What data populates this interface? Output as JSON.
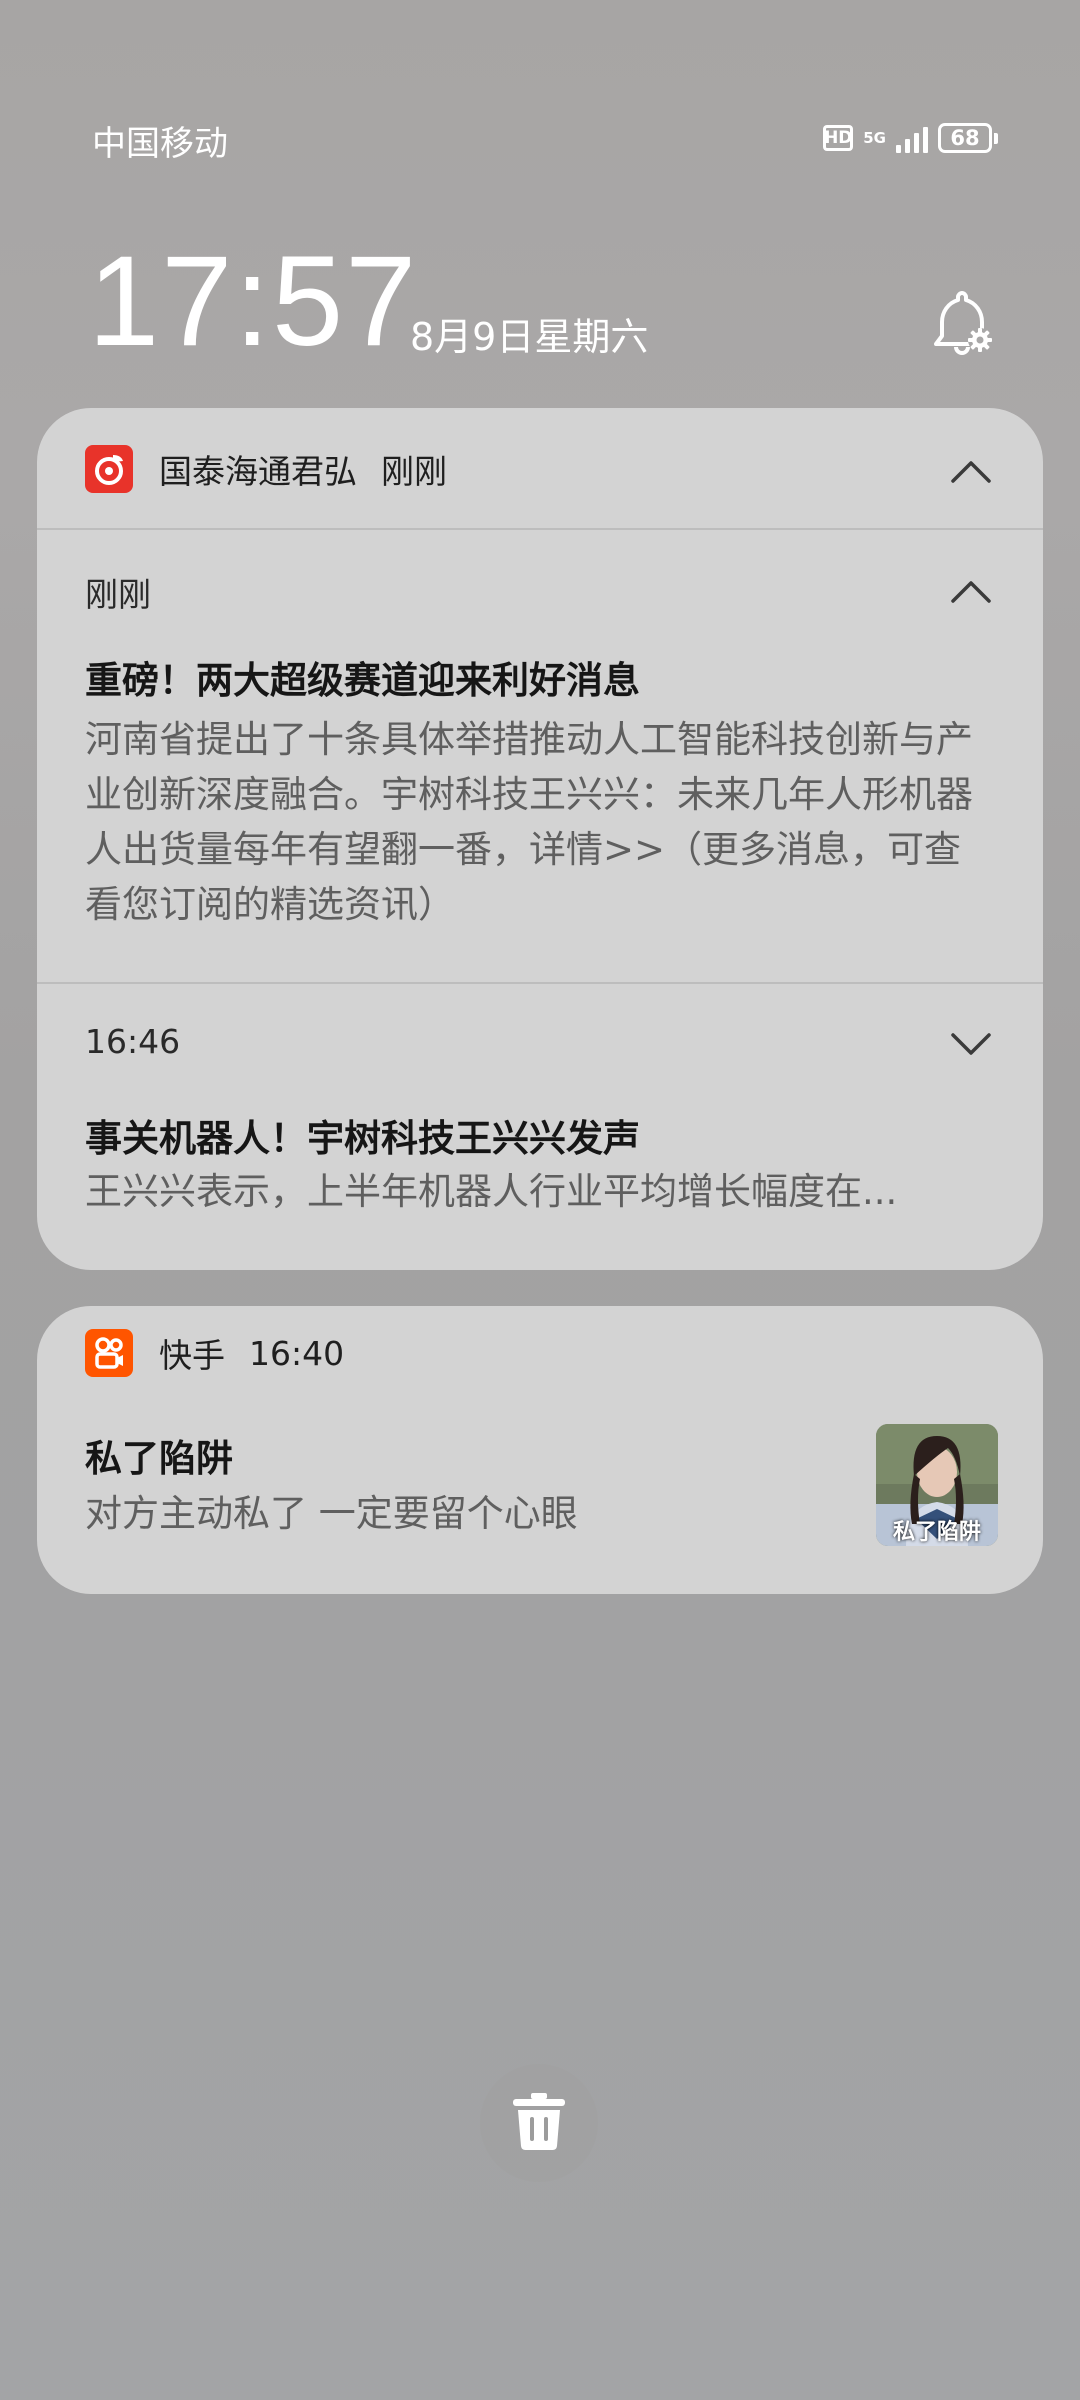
{
  "status_bar": {
    "carrier": "中国移动",
    "hd_label": "HD",
    "network_label": "5G",
    "battery_level": "68",
    "icons": [
      "hd-icon",
      "5g-icon",
      "signal-icon",
      "battery-icon"
    ]
  },
  "lockscreen": {
    "time": "17:57",
    "date": "8月9日星期六",
    "settings_icon": "notification-settings-icon"
  },
  "notifications": [
    {
      "app_name": "国泰海通君弘",
      "app_time": "刚刚",
      "app_icon": "guotai-haitong-app-icon",
      "accent_color": "#e8332a",
      "groups": [
        {
          "time": "刚刚",
          "title": "重磅！两大超级赛道迎来利好消息",
          "body": "河南省提出了十条具体举措推动人工智能科技创新与产业创新深度融合。宇树科技王兴兴：未来几年人形机器人出货量每年有望翻一番，详情>>（更多消息，可查看您订阅的精选资讯）"
        },
        {
          "time": "16:46",
          "title": "事关机器人！宇树科技王兴兴发声",
          "body": "王兴兴表示，上半年机器人行业平均增长幅度在..."
        }
      ]
    },
    {
      "app_name": "快手",
      "app_time": "16:40",
      "app_icon": "kuaishou-app-icon",
      "accent_color": "#ff5500",
      "title": "私了陷阱",
      "body": "对方主动私了 一定要留个心眼",
      "thumbnail_caption": "私了陷阱"
    }
  ],
  "actions": {
    "clear_icon": "trash-icon"
  }
}
